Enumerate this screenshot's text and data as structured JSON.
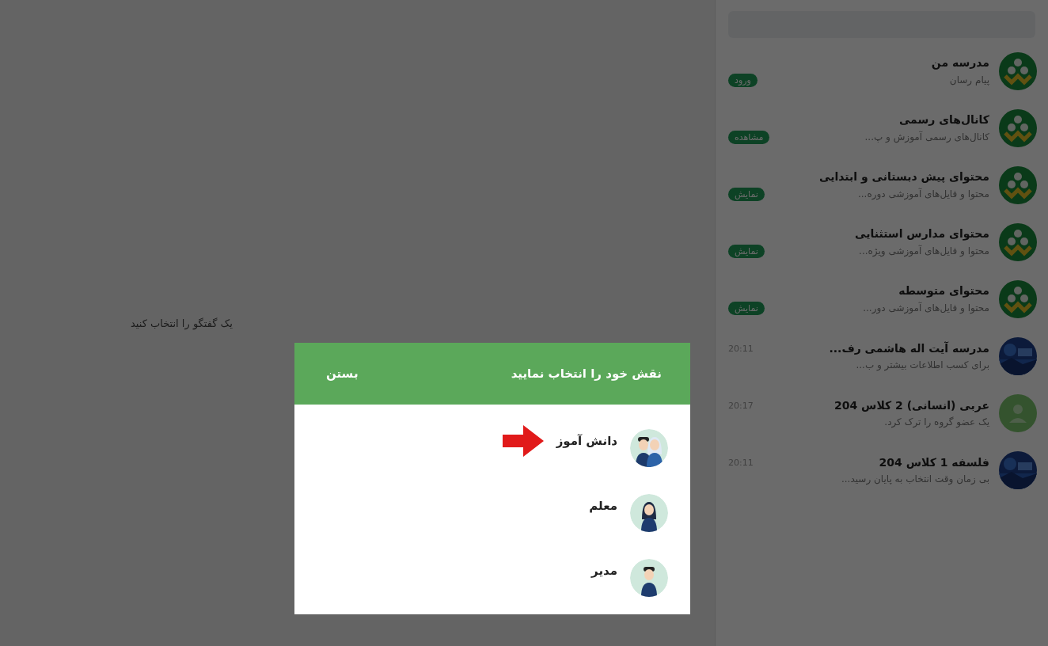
{
  "main": {
    "hint": "یک گفتگو را انتخاب کنید"
  },
  "chats": [
    {
      "kind": "channel",
      "avatar": {
        "kind": "logo"
      },
      "title": "مدرسه من",
      "subtitle": "پیام رسان",
      "badge": "ورود"
    },
    {
      "kind": "channel",
      "avatar": {
        "kind": "logo"
      },
      "title": "کانال‌های رسمی",
      "subtitle": "کانال‌های رسمی آموزش و پ...",
      "badge": "مشاهده"
    },
    {
      "kind": "channel",
      "avatar": {
        "kind": "logo"
      },
      "title": "محتوای پیش دبستانی و ابتدایی",
      "subtitle": "محتوا و فایل‌های آموزشی دوره...",
      "badge": "نمایش"
    },
    {
      "kind": "channel",
      "avatar": {
        "kind": "logo"
      },
      "title": "محتوای مدارس استثنایی",
      "subtitle": "محتوا و فایل‌های آموزشی ویژه...",
      "badge": "نمایش"
    },
    {
      "kind": "channel",
      "avatar": {
        "kind": "logo"
      },
      "title": "محتوای متوسطه",
      "subtitle": "محتوا و فایل‌های آموزشی دور...",
      "badge": "نمایش"
    },
    {
      "kind": "chat",
      "title": "مدرسه آیت اله هاشمی رف...",
      "subtitle": "برای کسب اطلاعات بیشتر و ب...",
      "time": "20:11"
    },
    {
      "kind": "chat",
      "avatar": {
        "kind": "group"
      },
      "title": "عربی (انسانی) 2 کلاس 204",
      "subtitle": "یک عضو گروه را ترک کرد.",
      "time": "20:17"
    },
    {
      "kind": "chat",
      "title": "فلسفه 1 کلاس 204",
      "subtitle": "بی زمان وقت انتخاب به پایان رسید...",
      "time": "20:11"
    }
  ],
  "dialog": {
    "title": "نقش خود را انتخاب نمایید",
    "close": "بستن",
    "roles": [
      {
        "label": "دانش آموز",
        "kind": "pair",
        "arrow": true
      },
      {
        "label": "معلم",
        "kind": "woman",
        "arrow": false
      },
      {
        "label": "مدیر",
        "kind": "man",
        "arrow": false
      }
    ]
  }
}
